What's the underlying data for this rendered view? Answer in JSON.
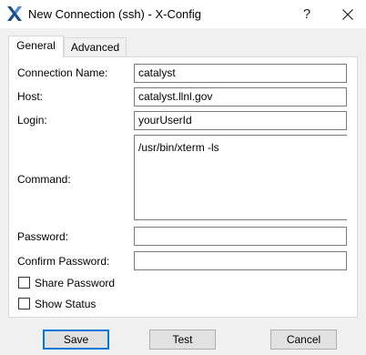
{
  "window": {
    "title": "New Connection (ssh) - X-Config",
    "help_glyph": "?"
  },
  "tabs": [
    {
      "label": "General",
      "active": true
    },
    {
      "label": "Advanced",
      "active": false
    }
  ],
  "form": {
    "connection_name": {
      "label": "Connection Name:",
      "value": "catalyst"
    },
    "host": {
      "label": "Host:",
      "value": "catalyst.llnl.gov"
    },
    "login": {
      "label": "Login:",
      "value": "yourUserId"
    },
    "command": {
      "label": "Command:",
      "value": "/usr/bin/xterm -ls"
    },
    "password": {
      "label": "Password:",
      "value": ""
    },
    "confirm_password": {
      "label": "Confirm Password:",
      "value": ""
    },
    "share_password": {
      "label": "Share Password",
      "checked": false
    },
    "show_status": {
      "label": "Show Status",
      "checked": false
    }
  },
  "buttons": {
    "save": "Save",
    "test": "Test",
    "cancel": "Cancel"
  },
  "colors": {
    "accent": "#0078d7",
    "icon_blue": "#1f4e8c"
  },
  "icons": {
    "app": "x-config-icon",
    "close": "close-icon"
  }
}
